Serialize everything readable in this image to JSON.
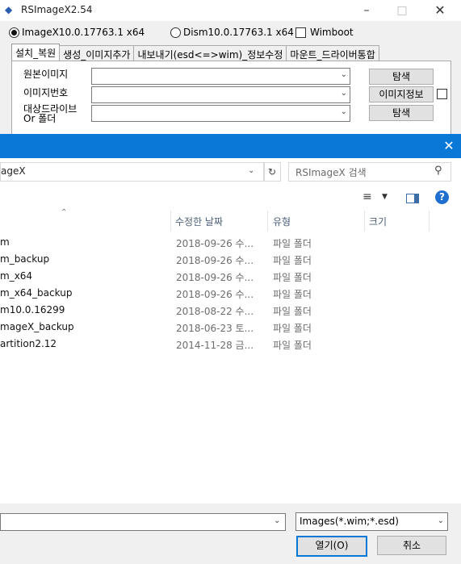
{
  "bg_window": {
    "title": "RSImageX2.54",
    "radio_1": "ImageX10.0.17763.1 x64",
    "radio_2": "Dism10.0.17763.1 x64",
    "checkbox": "Wimboot",
    "tabs": [
      "설치_복원",
      "생성_이미지추가",
      "내보내기(esd<=>wim)_정보수정",
      "마운트_드라이버통합"
    ],
    "fields": {
      "source_label": "원본이미지",
      "index_label": "이미지번호",
      "target_label_1": "대상드라이브",
      "target_label_2": "Or 폴더"
    },
    "buttons": {
      "browse_1": "탐색",
      "image_info": "이미지정보",
      "browse_2": "탐색"
    }
  },
  "dialog": {
    "address_text": "ageX",
    "search_placeholder": "RSImageX 검색",
    "columns": {
      "date": "수정한 날짜",
      "type": "유형",
      "size": "크기"
    },
    "files": [
      {
        "name": "m",
        "date": "2018-09-26 수...",
        "type": "파일 폴더"
      },
      {
        "name": "m_backup",
        "date": "2018-09-26 수...",
        "type": "파일 폴더"
      },
      {
        "name": "m_x64",
        "date": "2018-09-26 수...",
        "type": "파일 폴더"
      },
      {
        "name": "m_x64_backup",
        "date": "2018-09-26 수...",
        "type": "파일 폴더"
      },
      {
        "name": "m10.0.16299",
        "date": "2018-08-22 수...",
        "type": "파일 폴더"
      },
      {
        "name": "mageX_backup",
        "date": "2018-06-23 토...",
        "type": "파일 폴더"
      },
      {
        "name": "artition2.12",
        "date": "2014-11-28 금...",
        "type": "파일 폴더"
      }
    ],
    "filter": "Images(*.wim;*.esd)",
    "open_label": "열기(O)",
    "cancel_label": "취소"
  },
  "colors": {
    "titlebar_blue": "#0a78d7",
    "accent": "#0078d7"
  }
}
